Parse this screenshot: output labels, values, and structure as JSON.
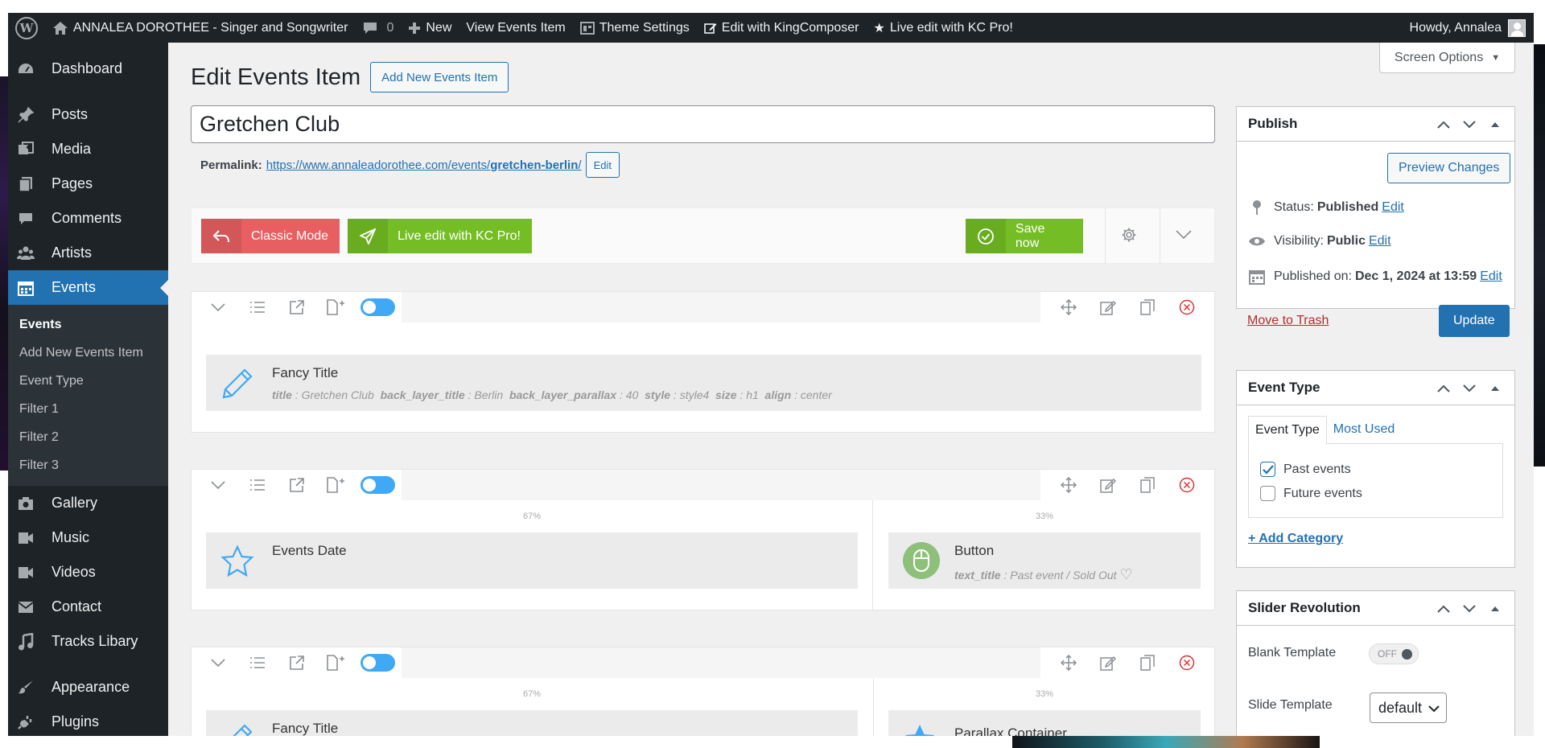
{
  "adminbar": {
    "site_name": "ANNALEA DOROTHEE - Singer and Songwriter",
    "comments_count": "0",
    "new_label": "New",
    "view_label": "View Events Item",
    "theme_settings_label": "Theme Settings",
    "edit_kc_label": "Edit with KingComposer",
    "live_edit_label": "Live edit with KC Pro!",
    "howdy": "Howdy, Annalea"
  },
  "sidebar": {
    "items": [
      {
        "label": "Dashboard",
        "icon": "dashboard-icon"
      },
      {
        "label": "Posts",
        "icon": "pin-icon"
      },
      {
        "label": "Media",
        "icon": "media-icon"
      },
      {
        "label": "Pages",
        "icon": "pages-icon"
      },
      {
        "label": "Comments",
        "icon": "comment-icon"
      },
      {
        "label": "Artists",
        "icon": "users-icon"
      },
      {
        "label": "Events",
        "icon": "calendar-icon"
      },
      {
        "label": "Gallery",
        "icon": "camera-icon"
      },
      {
        "label": "Music",
        "icon": "video-icon"
      },
      {
        "label": "Videos",
        "icon": "video-icon"
      },
      {
        "label": "Contact",
        "icon": "envelope-icon"
      },
      {
        "label": "Tracks Libary",
        "icon": "music-note-icon"
      },
      {
        "label": "Appearance",
        "icon": "brush-icon"
      },
      {
        "label": "Plugins",
        "icon": "plug-icon"
      }
    ],
    "submenu": [
      "Events",
      "Add New Events Item",
      "Event Type",
      "Filter 1",
      "Filter 2",
      "Filter 3"
    ]
  },
  "page": {
    "title": "Edit Events Item",
    "add_new_label": "Add New Events Item",
    "screen_options": "Screen Options",
    "post_title": "Gretchen Club",
    "permalink_label": "Permalink:",
    "permalink_base": "https://www.annaleadorothee.com/events/",
    "permalink_slug": "gretchen-berlin",
    "permalink_trail": "/",
    "permalink_edit": "Edit"
  },
  "kc": {
    "classic_mode": "Classic Mode",
    "live_edit": "Live edit with KC Pro!",
    "save_now": "Save now",
    "rows": [
      {
        "columns": [
          {
            "element": "Fancy Title",
            "params": [
              {
                "k": "title",
                "v": "Gretchen Club"
              },
              {
                "k": "back_layer_title",
                "v": "Berlin"
              },
              {
                "k": "back_layer_parallax",
                "v": "40"
              },
              {
                "k": "style",
                "v": "style4"
              },
              {
                "k": "size",
                "v": "h1"
              },
              {
                "k": "align",
                "v": "center"
              }
            ]
          }
        ]
      },
      {
        "columns": [
          {
            "pct": "67%",
            "element": "Events Date"
          },
          {
            "pct": "33%",
            "element": "Button",
            "params": [
              {
                "k": "text_title",
                "v": "Past event / Sold Out"
              }
            ]
          }
        ]
      },
      {
        "columns": [
          {
            "pct": "67%",
            "element": "Fancy Title"
          },
          {
            "pct": "33%",
            "element": "Parallax Container"
          }
        ]
      }
    ]
  },
  "publish": {
    "title": "Publish",
    "preview": "Preview Changes",
    "status_label": "Status:",
    "status_value": "Published",
    "visibility_label": "Visibility:",
    "visibility_value": "Public",
    "published_label": "Published on:",
    "published_value": "Dec 1, 2024 at 13:59",
    "edit": "Edit",
    "trash": "Move to Trash",
    "update": "Update"
  },
  "event_type": {
    "title": "Event Type",
    "tab_all": "Event Type",
    "tab_used": "Most Used",
    "options": [
      {
        "label": "Past events",
        "checked": true
      },
      {
        "label": "Future events",
        "checked": false
      }
    ],
    "add_category": "+ Add Category"
  },
  "slider": {
    "title": "Slider Revolution",
    "blank_label": "Blank Template",
    "blank_state": "OFF",
    "slide_label": "Slide Template",
    "slide_value": "default"
  }
}
